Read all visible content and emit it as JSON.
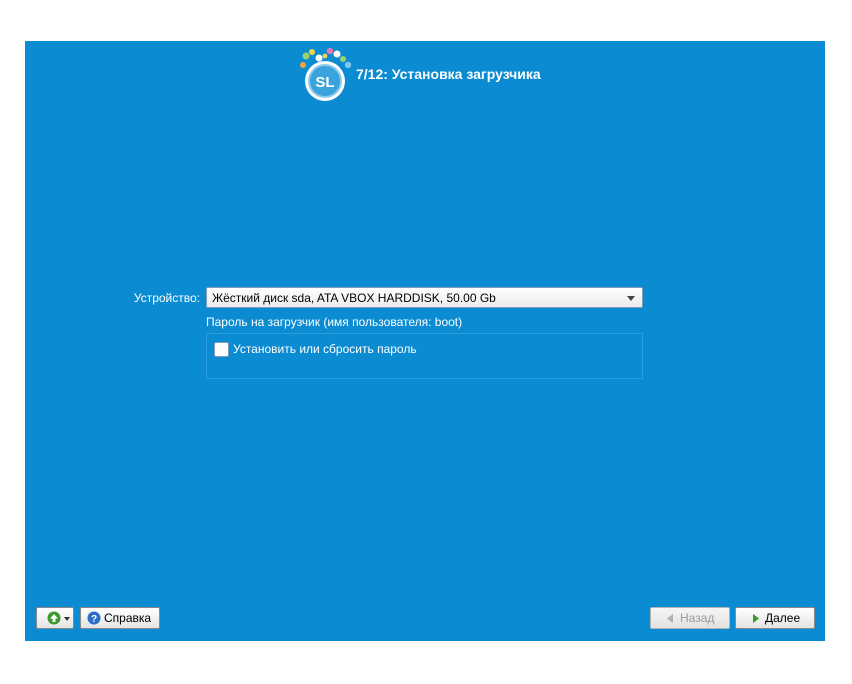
{
  "header": {
    "title": "7/12: Установка загрузчика",
    "logo_text": "SL"
  },
  "form": {
    "device_label": "Устройство:",
    "device_value": "Жёсткий диск sda, ATA VBOX HARDDISK, 50.00 Gb",
    "password_label": "Пароль на загрузчик (имя пользователя: boot)",
    "password_checkbox_label": "Установить или сбросить пароль",
    "password_checkbox_checked": false
  },
  "footer": {
    "menu_icon": "green-arrow-up-icon",
    "help_label": "Справка",
    "back_label": "Назад",
    "back_enabled": false,
    "next_label": "Далее"
  },
  "colors": {
    "background": "#0a8bd2",
    "text": "#ffffff"
  }
}
